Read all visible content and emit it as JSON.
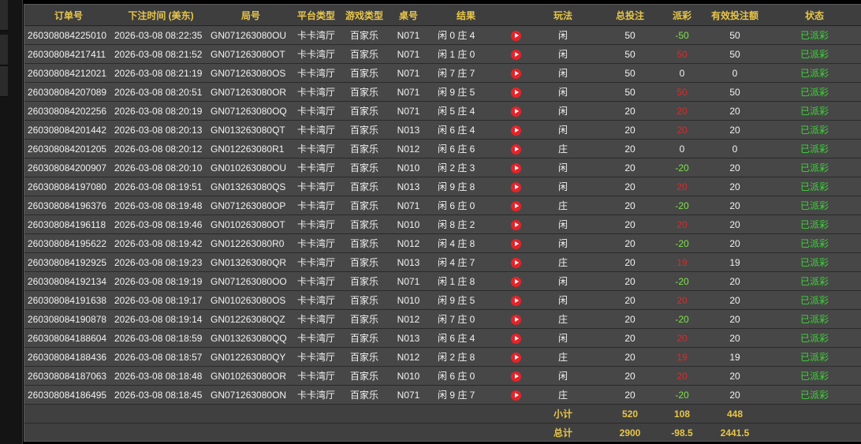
{
  "columns": [
    "订单号",
    "下注时间 (美东)",
    "局号",
    "平台类型",
    "游戏类型",
    "桌号",
    "结果",
    "",
    "玩法",
    "总投注",
    "派彩",
    "有效投注额",
    "状态"
  ],
  "colors": {
    "header": "#e8c64a",
    "payout_positive": "#7ee34c",
    "payout_negative": "#e0282a",
    "status": "#3fd43a",
    "play_button": "#e5232a"
  },
  "rows": [
    {
      "order": "260308084225010",
      "time": "2026-03-08 08:22:35",
      "round": "GN071263080OU",
      "platform": "卡卡湾厅",
      "game": "百家乐",
      "table": "N071",
      "result": "闲 0 庄 4",
      "bet_type": "闲",
      "total_bet": "50",
      "payout": "-50",
      "payout_color": "pos",
      "valid_bet": "50",
      "status": "已派彩"
    },
    {
      "order": "260308084217411",
      "time": "2026-03-08 08:21:52",
      "round": "GN071263080OT",
      "platform": "卡卡湾厅",
      "game": "百家乐",
      "table": "N071",
      "result": "闲 1 庄 0",
      "bet_type": "闲",
      "total_bet": "50",
      "payout": "50",
      "payout_color": "neg",
      "valid_bet": "50",
      "status": "已派彩"
    },
    {
      "order": "260308084212021",
      "time": "2026-03-08 08:21:19",
      "round": "GN071263080OS",
      "platform": "卡卡湾厅",
      "game": "百家乐",
      "table": "N071",
      "result": "闲 7 庄 7",
      "bet_type": "闲",
      "total_bet": "50",
      "payout": "0",
      "payout_color": "zero",
      "valid_bet": "0",
      "status": "已派彩"
    },
    {
      "order": "260308084207089",
      "time": "2026-03-08 08:20:51",
      "round": "GN071263080OR",
      "platform": "卡卡湾厅",
      "game": "百家乐",
      "table": "N071",
      "result": "闲 9 庄 5",
      "bet_type": "闲",
      "total_bet": "50",
      "payout": "50",
      "payout_color": "neg",
      "valid_bet": "50",
      "status": "已派彩"
    },
    {
      "order": "260308084202256",
      "time": "2026-03-08 08:20:19",
      "round": "GN071263080OQ",
      "platform": "卡卡湾厅",
      "game": "百家乐",
      "table": "N071",
      "result": "闲 5 庄 4",
      "bet_type": "闲",
      "total_bet": "20",
      "payout": "20",
      "payout_color": "neg",
      "valid_bet": "20",
      "status": "已派彩"
    },
    {
      "order": "260308084201442",
      "time": "2026-03-08 08:20:13",
      "round": "GN013263080QT",
      "platform": "卡卡湾厅",
      "game": "百家乐",
      "table": "N013",
      "result": "闲 6 庄 4",
      "bet_type": "闲",
      "total_bet": "20",
      "payout": "20",
      "payout_color": "neg",
      "valid_bet": "20",
      "status": "已派彩"
    },
    {
      "order": "260308084201205",
      "time": "2026-03-08 08:20:12",
      "round": "GN012263080R1",
      "platform": "卡卡湾厅",
      "game": "百家乐",
      "table": "N012",
      "result": "闲 6 庄 6",
      "bet_type": "庄",
      "total_bet": "20",
      "payout": "0",
      "payout_color": "zero",
      "valid_bet": "0",
      "status": "已派彩"
    },
    {
      "order": "260308084200907",
      "time": "2026-03-08 08:20:10",
      "round": "GN010263080OU",
      "platform": "卡卡湾厅",
      "game": "百家乐",
      "table": "N010",
      "result": "闲 2 庄 3",
      "bet_type": "闲",
      "total_bet": "20",
      "payout": "-20",
      "payout_color": "pos",
      "valid_bet": "20",
      "status": "已派彩"
    },
    {
      "order": "260308084197080",
      "time": "2026-03-08 08:19:51",
      "round": "GN013263080QS",
      "platform": "卡卡湾厅",
      "game": "百家乐",
      "table": "N013",
      "result": "闲 9 庄 8",
      "bet_type": "闲",
      "total_bet": "20",
      "payout": "20",
      "payout_color": "neg",
      "valid_bet": "20",
      "status": "已派彩"
    },
    {
      "order": "260308084196376",
      "time": "2026-03-08 08:19:48",
      "round": "GN071263080OP",
      "platform": "卡卡湾厅",
      "game": "百家乐",
      "table": "N071",
      "result": "闲 6 庄 0",
      "bet_type": "庄",
      "total_bet": "20",
      "payout": "-20",
      "payout_color": "pos",
      "valid_bet": "20",
      "status": "已派彩"
    },
    {
      "order": "260308084196118",
      "time": "2026-03-08 08:19:46",
      "round": "GN010263080OT",
      "platform": "卡卡湾厅",
      "game": "百家乐",
      "table": "N010",
      "result": "闲 8 庄 2",
      "bet_type": "闲",
      "total_bet": "20",
      "payout": "20",
      "payout_color": "neg",
      "valid_bet": "20",
      "status": "已派彩"
    },
    {
      "order": "260308084195622",
      "time": "2026-03-08 08:19:42",
      "round": "GN012263080R0",
      "platform": "卡卡湾厅",
      "game": "百家乐",
      "table": "N012",
      "result": "闲 4 庄 8",
      "bet_type": "闲",
      "total_bet": "20",
      "payout": "-20",
      "payout_color": "pos",
      "valid_bet": "20",
      "status": "已派彩"
    },
    {
      "order": "260308084192925",
      "time": "2026-03-08 08:19:23",
      "round": "GN013263080QR",
      "platform": "卡卡湾厅",
      "game": "百家乐",
      "table": "N013",
      "result": "闲 4 庄 7",
      "bet_type": "庄",
      "total_bet": "20",
      "payout": "19",
      "payout_color": "neg",
      "valid_bet": "19",
      "status": "已派彩"
    },
    {
      "order": "260308084192134",
      "time": "2026-03-08 08:19:19",
      "round": "GN071263080OO",
      "platform": "卡卡湾厅",
      "game": "百家乐",
      "table": "N071",
      "result": "闲 1 庄 8",
      "bet_type": "闲",
      "total_bet": "20",
      "payout": "-20",
      "payout_color": "pos",
      "valid_bet": "20",
      "status": "已派彩"
    },
    {
      "order": "260308084191638",
      "time": "2026-03-08 08:19:17",
      "round": "GN010263080OS",
      "platform": "卡卡湾厅",
      "game": "百家乐",
      "table": "N010",
      "result": "闲 9 庄 5",
      "bet_type": "闲",
      "total_bet": "20",
      "payout": "20",
      "payout_color": "neg",
      "valid_bet": "20",
      "status": "已派彩"
    },
    {
      "order": "260308084190878",
      "time": "2026-03-08 08:19:14",
      "round": "GN012263080QZ",
      "platform": "卡卡湾厅",
      "game": "百家乐",
      "table": "N012",
      "result": "闲 7 庄 0",
      "bet_type": "庄",
      "total_bet": "20",
      "payout": "-20",
      "payout_color": "pos",
      "valid_bet": "20",
      "status": "已派彩"
    },
    {
      "order": "260308084188604",
      "time": "2026-03-08 08:18:59",
      "round": "GN013263080QQ",
      "platform": "卡卡湾厅",
      "game": "百家乐",
      "table": "N013",
      "result": "闲 6 庄 4",
      "bet_type": "闲",
      "total_bet": "20",
      "payout": "20",
      "payout_color": "neg",
      "valid_bet": "20",
      "status": "已派彩"
    },
    {
      "order": "260308084188436",
      "time": "2026-03-08 08:18:57",
      "round": "GN012263080QY",
      "platform": "卡卡湾厅",
      "game": "百家乐",
      "table": "N012",
      "result": "闲 2 庄 8",
      "bet_type": "庄",
      "total_bet": "20",
      "payout": "19",
      "payout_color": "neg",
      "valid_bet": "19",
      "status": "已派彩"
    },
    {
      "order": "260308084187063",
      "time": "2026-03-08 08:18:48",
      "round": "GN010263080OR",
      "platform": "卡卡湾厅",
      "game": "百家乐",
      "table": "N010",
      "result": "闲 6 庄 0",
      "bet_type": "闲",
      "total_bet": "20",
      "payout": "20",
      "payout_color": "neg",
      "valid_bet": "20",
      "status": "已派彩"
    },
    {
      "order": "260308084186495",
      "time": "2026-03-08 08:18:45",
      "round": "GN071263080ON",
      "platform": "卡卡湾厅",
      "game": "百家乐",
      "table": "N071",
      "result": "闲 9 庄 7",
      "bet_type": "庄",
      "total_bet": "20",
      "payout": "-20",
      "payout_color": "pos",
      "valid_bet": "20",
      "status": "已派彩"
    }
  ],
  "subtotal": {
    "label": "小计",
    "total_bet": "520",
    "payout": "108",
    "valid_bet": "448"
  },
  "grand_total": {
    "label": "总计",
    "total_bet": "2900",
    "payout": "-98.5",
    "valid_bet": "2441.5"
  }
}
